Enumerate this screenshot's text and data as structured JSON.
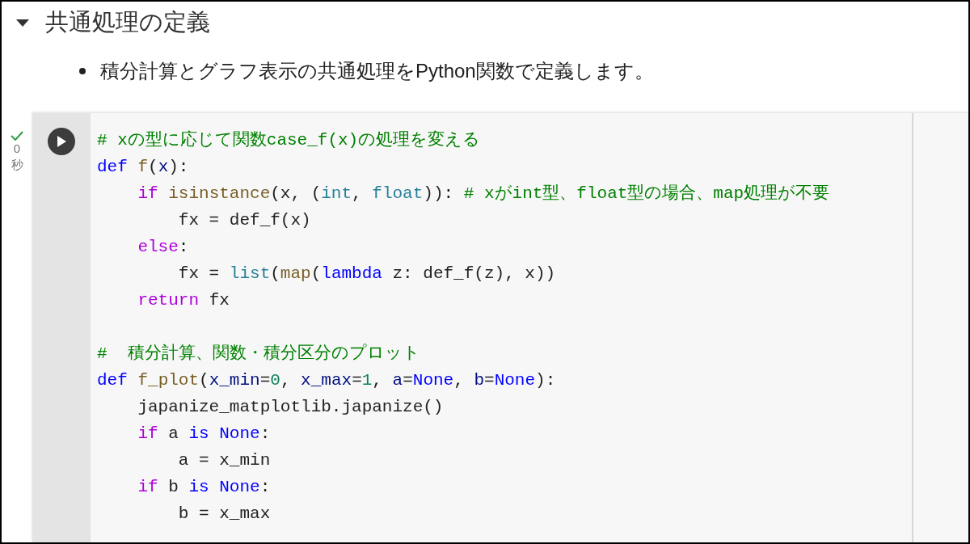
{
  "section": {
    "title": "共通処理の定義",
    "expanded": true
  },
  "bullets": [
    "積分計算とグラフ表示の共通処理をPython関数で定義します。"
  ],
  "cell": {
    "status": {
      "done": true,
      "time": "0",
      "unit": "秒"
    },
    "lines": [
      {
        "kind": "code",
        "tokens": [
          {
            "kind": "comment",
            "text": "# xの型に応じて関数case_f(x)の処理を変える"
          }
        ]
      },
      {
        "kind": "code",
        "tokens": [
          {
            "kind": "def",
            "text": "def "
          },
          {
            "kind": "func",
            "text": "f"
          },
          {
            "kind": "plain",
            "text": "("
          },
          {
            "kind": "param",
            "text": "x"
          },
          {
            "kind": "plain",
            "text": "):"
          }
        ]
      },
      {
        "kind": "code",
        "tokens": [
          {
            "kind": "keyword",
            "text": "    if "
          },
          {
            "kind": "func",
            "text": "isinstance"
          },
          {
            "kind": "plain",
            "text": "(x, ("
          },
          {
            "kind": "type",
            "text": "int"
          },
          {
            "kind": "plain",
            "text": ", "
          },
          {
            "kind": "type",
            "text": "float"
          },
          {
            "kind": "plain",
            "text": ")): "
          },
          {
            "kind": "comment",
            "text": "# xがint型、float型の場合、map処理が不要"
          }
        ]
      },
      {
        "kind": "code",
        "tokens": [
          {
            "kind": "plain",
            "text": "        fx = def_f(x)"
          }
        ]
      },
      {
        "kind": "code",
        "tokens": [
          {
            "kind": "keyword",
            "text": "    else"
          },
          {
            "kind": "plain",
            "text": ":"
          }
        ]
      },
      {
        "kind": "code",
        "tokens": [
          {
            "kind": "plain",
            "text": "        fx = "
          },
          {
            "kind": "type",
            "text": "list"
          },
          {
            "kind": "plain",
            "text": "("
          },
          {
            "kind": "func",
            "text": "map"
          },
          {
            "kind": "plain",
            "text": "("
          },
          {
            "kind": "def",
            "text": "lambda"
          },
          {
            "kind": "plain",
            "text": " z: def_f(z), x))"
          }
        ]
      },
      {
        "kind": "code",
        "tokens": [
          {
            "kind": "keyword",
            "text": "    return"
          },
          {
            "kind": "plain",
            "text": " fx"
          }
        ]
      },
      {
        "kind": "blank"
      },
      {
        "kind": "code",
        "tokens": [
          {
            "kind": "comment",
            "text": "#  積分計算、関数・積分区分のプロット"
          }
        ]
      },
      {
        "kind": "code",
        "tokens": [
          {
            "kind": "def",
            "text": "def "
          },
          {
            "kind": "func",
            "text": "f_plot"
          },
          {
            "kind": "plain",
            "text": "("
          },
          {
            "kind": "param",
            "text": "x_min"
          },
          {
            "kind": "plain",
            "text": "="
          },
          {
            "kind": "number",
            "text": "0"
          },
          {
            "kind": "plain",
            "text": ", "
          },
          {
            "kind": "param",
            "text": "x_max"
          },
          {
            "kind": "plain",
            "text": "="
          },
          {
            "kind": "number",
            "text": "1"
          },
          {
            "kind": "plain",
            "text": ", "
          },
          {
            "kind": "param",
            "text": "a"
          },
          {
            "kind": "plain",
            "text": "="
          },
          {
            "kind": "def",
            "text": "None"
          },
          {
            "kind": "plain",
            "text": ", "
          },
          {
            "kind": "param",
            "text": "b"
          },
          {
            "kind": "plain",
            "text": "="
          },
          {
            "kind": "def",
            "text": "None"
          },
          {
            "kind": "plain",
            "text": "):"
          }
        ]
      },
      {
        "kind": "code",
        "tokens": [
          {
            "kind": "plain",
            "text": "    japanize_matplotlib.japanize()"
          }
        ]
      },
      {
        "kind": "code",
        "tokens": [
          {
            "kind": "keyword",
            "text": "    if"
          },
          {
            "kind": "plain",
            "text": " a "
          },
          {
            "kind": "def",
            "text": "is None"
          },
          {
            "kind": "plain",
            "text": ":"
          }
        ]
      },
      {
        "kind": "code",
        "tokens": [
          {
            "kind": "plain",
            "text": "        a = x_min"
          }
        ]
      },
      {
        "kind": "code",
        "tokens": [
          {
            "kind": "keyword",
            "text": "    if"
          },
          {
            "kind": "plain",
            "text": " b "
          },
          {
            "kind": "def",
            "text": "is None"
          },
          {
            "kind": "plain",
            "text": ":"
          }
        ]
      },
      {
        "kind": "code",
        "tokens": [
          {
            "kind": "plain",
            "text": "        b = x_max"
          }
        ]
      }
    ]
  }
}
